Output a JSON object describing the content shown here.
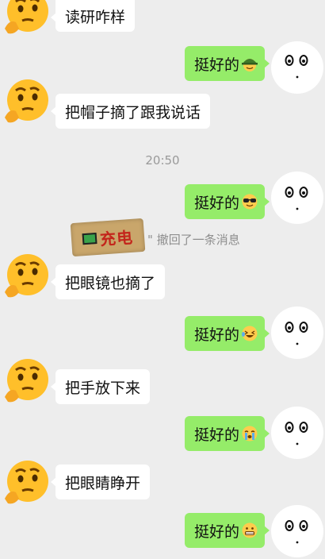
{
  "colors": {
    "background": "#ededed",
    "outgoing_bubble": "#95ec69",
    "incoming_bubble": "#ffffff",
    "meta_text": "#9a9a9a"
  },
  "messages": [
    {
      "side": "left",
      "text": "读研咋样",
      "avatar": "thinking-face-emoji"
    },
    {
      "side": "right",
      "text": "挺好的",
      "emoji": "army-helmet-emoji"
    },
    {
      "side": "left",
      "text": "把帽子摘了跟我说话",
      "avatar": "thinking-face-emoji"
    },
    {
      "side": "right",
      "text": "挺好的",
      "emoji": "sunglasses-emoji"
    },
    {
      "side": "left",
      "text": "把眼镜也摘了",
      "avatar": "thinking-face-emoji"
    },
    {
      "side": "right",
      "text": "挺好的",
      "emoji": "laughing-tears-emoji"
    },
    {
      "side": "left",
      "text": "把手放下来",
      "avatar": "thinking-face-emoji"
    },
    {
      "side": "right",
      "text": "挺好的",
      "emoji": "crying-emoji"
    },
    {
      "side": "left",
      "text": "把眼睛睁开",
      "avatar": "thinking-face-emoji"
    },
    {
      "side": "right",
      "text": "挺好的",
      "emoji": "grimace-emoji"
    }
  ],
  "timestamp": "20:50",
  "recall": {
    "sticker_text": "充电",
    "text": "撤回了一条消息",
    "quote_mark": "\""
  }
}
